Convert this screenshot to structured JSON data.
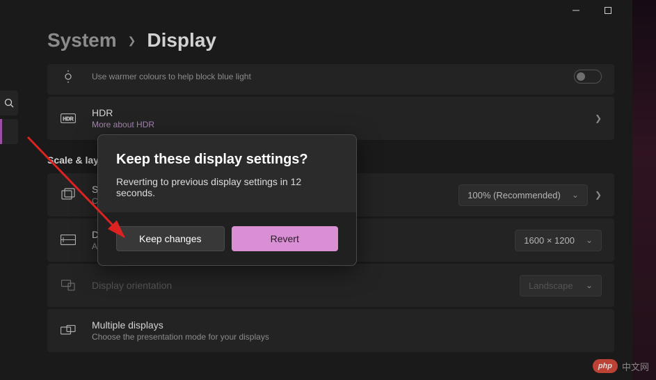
{
  "breadcrumb": {
    "parent": "System",
    "current": "Display"
  },
  "rows": {
    "nightlight_sub": "Use warmer colours to help block blue light",
    "hdr": {
      "title": "HDR",
      "sub": "More about HDR"
    },
    "scale": {
      "title": "Scale",
      "sub": "Change the size of text, apps, and other items",
      "value": "100% (Recommended)"
    },
    "resolution": {
      "title": "Display resolution",
      "sub": "Adjust the resolution to fit your connected display",
      "value": "1600 × 1200"
    },
    "orientation": {
      "title": "Display orientation",
      "value": "Landscape"
    },
    "multiple": {
      "title": "Multiple displays",
      "sub": "Choose the presentation mode for your displays"
    }
  },
  "section": {
    "scale_layout": "Scale & layout"
  },
  "dialog": {
    "title": "Keep these display settings?",
    "text": "Reverting to previous display settings in 12 seconds.",
    "keep": "Keep changes",
    "revert": "Revert"
  },
  "watermark": {
    "badge": "php",
    "text": "中文网"
  }
}
